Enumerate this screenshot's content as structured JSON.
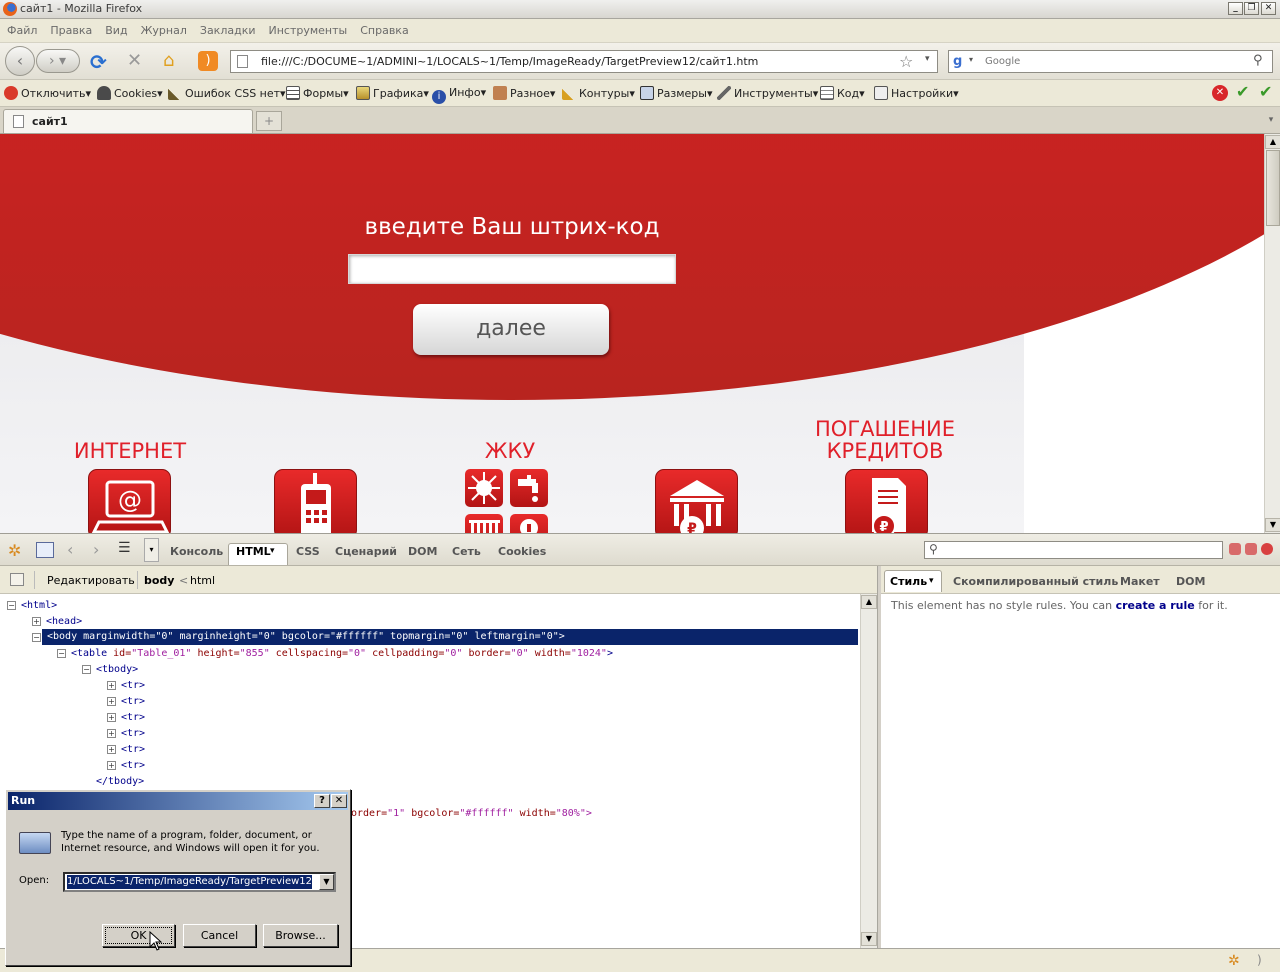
{
  "window": {
    "title": "сайт1 - Mozilla Firefox"
  },
  "menu": [
    "Файл",
    "Правка",
    "Вид",
    "Журнал",
    "Закладки",
    "Инструменты",
    "Справка"
  ],
  "nav": {
    "url": "file:///C:/DOCUME~1/ADMINI~1/LOCALS~1/Temp/ImageReady/TargetPreview12/сайт1.htm",
    "search_placeholder": "Google"
  },
  "devtoolbar": [
    "Отключить",
    "Cookies",
    "Ошибок CSS нет",
    "Формы",
    "Графика",
    "Инфо",
    "Разное",
    "Контуры",
    "Размеры",
    "Инструменты",
    "Код",
    "Настройки"
  ],
  "tabs": [
    {
      "label": "сайт1"
    }
  ],
  "site": {
    "prompt": "введите Ваш штрих-код",
    "next_label": "далее",
    "categories": [
      {
        "label": "ИНТЕРНЕТ",
        "icon": "laptop-at-icon"
      },
      {
        "label": "",
        "icon": "mobile-phone-icon"
      },
      {
        "label": "ЖКУ",
        "icon": "utilities-icon"
      },
      {
        "label": "",
        "icon": "bank-ruble-icon"
      },
      {
        "label": "ПОГАШЕНИЕ\nКРЕДИТОВ",
        "icon": "loan-document-icon"
      }
    ],
    "colors": {
      "brand_red": "#e62026",
      "background": "#eceef0"
    }
  },
  "firebug": {
    "tabs": [
      "Консоль",
      "HTML",
      "CSS",
      "Сценарий",
      "DOM",
      "Сеть",
      "Cookies"
    ],
    "active_tab": "HTML",
    "edit_label": "Редактировать",
    "breadcrumb": [
      "body",
      "html"
    ],
    "right_tabs": [
      "Стиль",
      "Скомпилированный стиль",
      "Макет",
      "DOM"
    ],
    "style_message_prefix": "This element has no style rules. You can ",
    "style_message_link": "create a rule",
    "style_message_suffix": " for it.",
    "tree": {
      "html": "<html>",
      "head": "<head>",
      "body": "<body marginwidth=\"0\" marginheight=\"0\" bgcolor=\"#ffffff\" topmargin=\"0\" leftmargin=\"0\">",
      "table_tag": "<table",
      "table_id_attr": "id=",
      "table_id_val": "\"Table_01\"",
      "table_h_attr": "height=",
      "table_h_val": "\"855\"",
      "table_cs_attr": "cellspacing=",
      "table_cs_val": "\"0\"",
      "table_cp_attr": "cellpadding=",
      "table_cp_val": "\"0\"",
      "table_b_attr": "border=",
      "table_b_val": "\"0\"",
      "table_w_attr": "width=",
      "table_w_val": "\"1024\"",
      "tbody": "<tbody>",
      "tr": "<tr>",
      "tbody_close": "</tbody>",
      "partial_attr1": "order=",
      "partial_val1": "\"1\"",
      "partial_attr2": "bgcolor=",
      "partial_val2": "\"#ffffff\"",
      "partial_attr3": "width=",
      "partial_val3": "\"80%\">"
    }
  },
  "run_dialog": {
    "title": "Run",
    "message": "Type the name of a program, folder, document, or Internet resource, and Windows will open it for you.",
    "open_label": "Open:",
    "open_value": "1/LOCALS~1/Temp/ImageReady/TargetPreview12",
    "ok_label": "OK",
    "cancel_label": "Cancel",
    "browse_label": "Browse..."
  }
}
